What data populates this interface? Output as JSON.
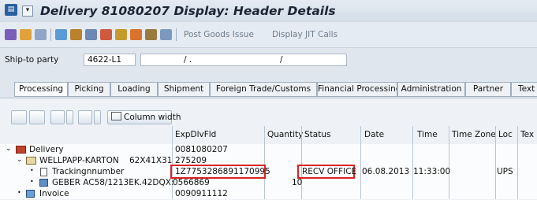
{
  "window": {
    "title": "Delivery 81080207 Display: Header Details"
  },
  "toolbar": {
    "post_goods_issue": "Post Goods Issue",
    "display_jit_calls": "Display JIT Calls"
  },
  "header": {
    "ship_to_label": "Ship-to party",
    "ship_to_value": "4622-L1",
    "address_sep1": "/ .",
    "address_sep2": "/"
  },
  "tabs": [
    {
      "label": "Processing"
    },
    {
      "label": "Picking"
    },
    {
      "label": "Loading"
    },
    {
      "label": "Shipment"
    },
    {
      "label": "Foreign Trade/Customs"
    },
    {
      "label": "Financial Processing"
    },
    {
      "label": "Administration"
    },
    {
      "label": "Partner"
    },
    {
      "label": "Text"
    }
  ],
  "tree_toolbar": {
    "column_width_label": "Column width"
  },
  "columns": {
    "expdlvfld": "ExpDlvFld",
    "quantity": "Quantity",
    "status": "Status",
    "date": "Date",
    "time": "Time",
    "time_zone": "Time Zone",
    "loc": "Loc",
    "text": "Tex"
  },
  "rows": [
    {
      "label": "Delivery",
      "expdlvfld": "0081080207",
      "quantity": "",
      "status": "",
      "date": "",
      "time": "",
      "loc": ""
    },
    {
      "label": "WELLPAPP-KARTON",
      "label2": "62X41X31",
      "expdlvfld": "275209",
      "quantity": "",
      "status": "",
      "date": "",
      "time": "",
      "loc": ""
    },
    {
      "label": "Trackingnnumber",
      "expdlvfld": "1Z7753286891170995",
      "quantity": "",
      "status": "RECV OFFICE",
      "date": "06.08.2013",
      "time": "11:33:00",
      "loc": "UPS"
    },
    {
      "label": "GEBER AC58/1213EK.42DQX:",
      "expdlvfld": "0566869",
      "quantity": "10",
      "status": "",
      "date": "",
      "time": "",
      "loc": ""
    },
    {
      "label": "Invoice",
      "expdlvfld": "0090911112",
      "quantity": "",
      "status": "",
      "date": "",
      "time": "",
      "loc": ""
    }
  ],
  "colors": {
    "highlight": "#d22222",
    "background": "#dfe6ee"
  }
}
